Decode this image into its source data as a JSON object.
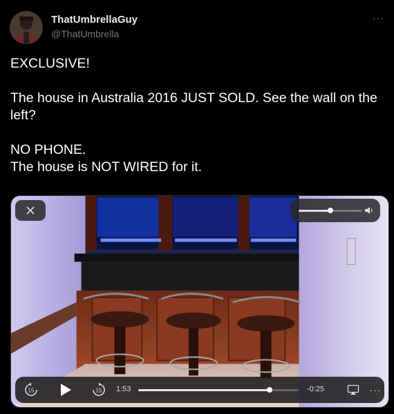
{
  "user": {
    "display_name": "ThatUmbrellaGuy",
    "handle": "@ThatUmbrella"
  },
  "more_icon": "more-icon",
  "tweet": {
    "lines": [
      "EXCLUSIVE!",
      "",
      "The house in Australia 2016 JUST SOLD. See the wall on the left?",
      "",
      "NO PHONE.",
      "The house is NOT WIRED for it."
    ]
  },
  "video": {
    "elapsed": "1:53",
    "remaining": "-0:25",
    "progress_fraction": 0.82,
    "volume_fraction": 0.5,
    "skip_back_label": "15",
    "skip_forward_label": "15",
    "icons": [
      "close-icon",
      "volume-icon",
      "skip-back-icon",
      "play-icon",
      "skip-forward-icon",
      "airplay-icon",
      "more-icon"
    ]
  },
  "colors": {
    "background": "#000000",
    "text": "#ffffff",
    "secondary": "#71767b",
    "led": "#3a5bff"
  }
}
